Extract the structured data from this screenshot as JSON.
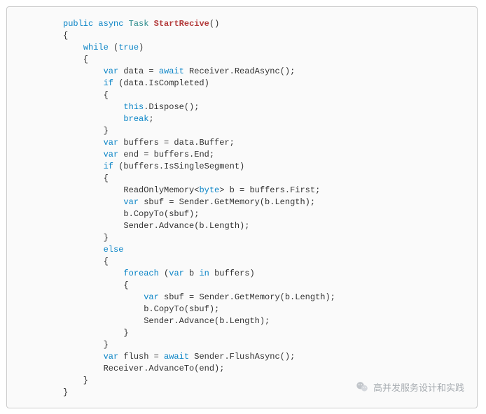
{
  "watermark": {
    "text": "高并发服务设计和实践"
  },
  "code": {
    "lines": [
      [
        [
          "kw",
          "public"
        ],
        [
          "s",
          " "
        ],
        [
          "kw",
          "async"
        ],
        [
          "s",
          " "
        ],
        [
          "ty",
          "Task"
        ],
        [
          "s",
          " "
        ],
        [
          "fn",
          "StartRecive"
        ],
        [
          "p",
          "()"
        ]
      ],
      [
        [
          "p",
          "{"
        ]
      ],
      [
        [
          "in",
          1
        ],
        [
          "kw",
          "while"
        ],
        [
          "s",
          " "
        ],
        [
          "p",
          "("
        ],
        [
          "kw",
          "true"
        ],
        [
          "p",
          ")"
        ]
      ],
      [
        [
          "in",
          1
        ],
        [
          "p",
          "{"
        ]
      ],
      [
        [
          "in",
          2
        ],
        [
          "kw",
          "var"
        ],
        [
          "s",
          " data = "
        ],
        [
          "kw",
          "await"
        ],
        [
          "s",
          " Receiver.ReadAsync();"
        ]
      ],
      [
        [
          "in",
          2
        ],
        [
          "kw",
          "if"
        ],
        [
          "s",
          " (data.IsCompleted)"
        ]
      ],
      [
        [
          "in",
          2
        ],
        [
          "p",
          "{"
        ]
      ],
      [
        [
          "in",
          3
        ],
        [
          "kw",
          "this"
        ],
        [
          "s",
          ".Dispose();"
        ]
      ],
      [
        [
          "in",
          3
        ],
        [
          "kw",
          "break"
        ],
        [
          "s",
          ";"
        ]
      ],
      [
        [
          "in",
          2
        ],
        [
          "p",
          "}"
        ]
      ],
      [
        [
          "in",
          2
        ],
        [
          "kw",
          "var"
        ],
        [
          "s",
          " buffers = data.Buffer;"
        ]
      ],
      [
        [
          "in",
          2
        ],
        [
          "kw",
          "var"
        ],
        [
          "s",
          " end = buffers.End;"
        ]
      ],
      [
        [
          "in",
          2
        ],
        [
          "kw",
          "if"
        ],
        [
          "s",
          " (buffers.IsSingleSegment)"
        ]
      ],
      [
        [
          "in",
          2
        ],
        [
          "p",
          "{"
        ]
      ],
      [
        [
          "in",
          3
        ],
        [
          "s",
          "ReadOnlyMemory<"
        ],
        [
          "kw",
          "byte"
        ],
        [
          "s",
          "> b = buffers.First;"
        ]
      ],
      [
        [
          "in",
          3
        ],
        [
          "kw",
          "var"
        ],
        [
          "s",
          " sbuf = Sender.GetMemory(b.Length);"
        ]
      ],
      [
        [
          "in",
          3
        ],
        [
          "s",
          "b.CopyTo(sbuf);"
        ]
      ],
      [
        [
          "in",
          3
        ],
        [
          "s",
          "Sender.Advance(b.Length);"
        ]
      ],
      [
        [
          "in",
          2
        ],
        [
          "p",
          "}"
        ]
      ],
      [
        [
          "in",
          2
        ],
        [
          "kw",
          "else"
        ]
      ],
      [
        [
          "in",
          2
        ],
        [
          "p",
          "{"
        ]
      ],
      [
        [
          "in",
          3
        ],
        [
          "kw",
          "foreach"
        ],
        [
          "s",
          " ("
        ],
        [
          "kw",
          "var"
        ],
        [
          "s",
          " b "
        ],
        [
          "kw",
          "in"
        ],
        [
          "s",
          " buffers)"
        ]
      ],
      [
        [
          "in",
          3
        ],
        [
          "p",
          "{"
        ]
      ],
      [
        [
          "in",
          4
        ],
        [
          "kw",
          "var"
        ],
        [
          "s",
          " sbuf = Sender.GetMemory(b.Length);"
        ]
      ],
      [
        [
          "in",
          4
        ],
        [
          "s",
          "b.CopyTo(sbuf);"
        ]
      ],
      [
        [
          "in",
          4
        ],
        [
          "s",
          "Sender.Advance(b.Length);"
        ]
      ],
      [
        [
          "in",
          3
        ],
        [
          "p",
          "}"
        ]
      ],
      [
        [
          "in",
          2
        ],
        [
          "p",
          "}"
        ]
      ],
      [
        [
          "in",
          2
        ],
        [
          "kw",
          "var"
        ],
        [
          "s",
          " flush = "
        ],
        [
          "kw",
          "await"
        ],
        [
          "s",
          " Sender.FlushAsync();"
        ]
      ],
      [
        [
          "in",
          2
        ],
        [
          "s",
          "Receiver.AdvanceTo(end);"
        ]
      ],
      [
        [
          "in",
          1
        ],
        [
          "p",
          "}"
        ]
      ],
      [
        [
          "p",
          "}"
        ]
      ]
    ]
  }
}
